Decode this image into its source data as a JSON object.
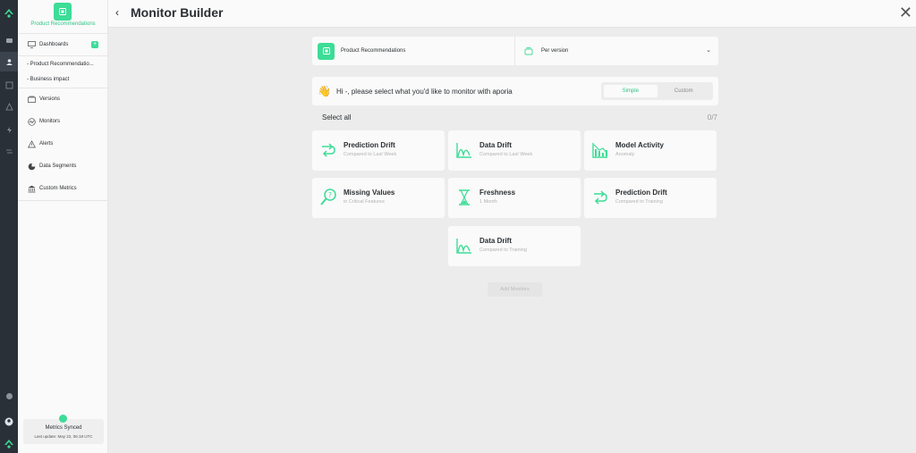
{
  "sidebar": {
    "model_name": "Product Recommendations",
    "dashboards_label": "Dashboards",
    "dashboards_add": "+",
    "dashboard_items": [
      "- Product Recommendatio...",
      "- Business impact"
    ],
    "items": [
      {
        "label": "Versions",
        "icon": "versions-icon"
      },
      {
        "label": "Monitors",
        "icon": "monitors-icon"
      },
      {
        "label": "Alerts",
        "icon": "alert-icon"
      },
      {
        "label": "Data Segments",
        "icon": "pie-icon"
      },
      {
        "label": "Custom Metrics",
        "icon": "bank-icon"
      }
    ],
    "sync": {
      "title": "Metrics Synced",
      "subtitle": "Last update: May 22, 06:18 UTC"
    }
  },
  "header": {
    "back": "‹",
    "title": "Monitor Builder",
    "close": "✕"
  },
  "selector": {
    "model": "Product Recommendations",
    "version": "Per version",
    "chevron": "⌄"
  },
  "greeting": {
    "emoji": "👋",
    "text": "Hi -, please select what you'd like to monitor with aporia",
    "modes": {
      "simple": "Simple",
      "custom": "Custom",
      "active": "Simple"
    }
  },
  "select_all": "Select all",
  "counter": "0/7",
  "cards": [
    {
      "title": "Prediction Drift",
      "subtitle": "Compared to Last Week",
      "icon": "drift-arrows-icon"
    },
    {
      "title": "Data Drift",
      "subtitle": "Compared to Last Week",
      "icon": "distribution-icon"
    },
    {
      "title": "Model Activity",
      "subtitle": "Anomaly",
      "icon": "bar-trend-icon"
    },
    {
      "title": "Missing Values",
      "subtitle": "in Critical Features",
      "icon": "magnifier-icon"
    },
    {
      "title": "Freshness",
      "subtitle": "1 Month",
      "icon": "hourglass-icon"
    },
    {
      "title": "Prediction Drift",
      "subtitle": "Compared to Training",
      "icon": "drift-arrows-icon"
    },
    {
      "title": "Data Drift",
      "subtitle": "Compared to Training",
      "icon": "distribution-icon"
    }
  ],
  "add_button": "Add Monitors",
  "colors": {
    "accent": "#3ddc97",
    "rail": "#2a3038",
    "background": "#ececec"
  }
}
